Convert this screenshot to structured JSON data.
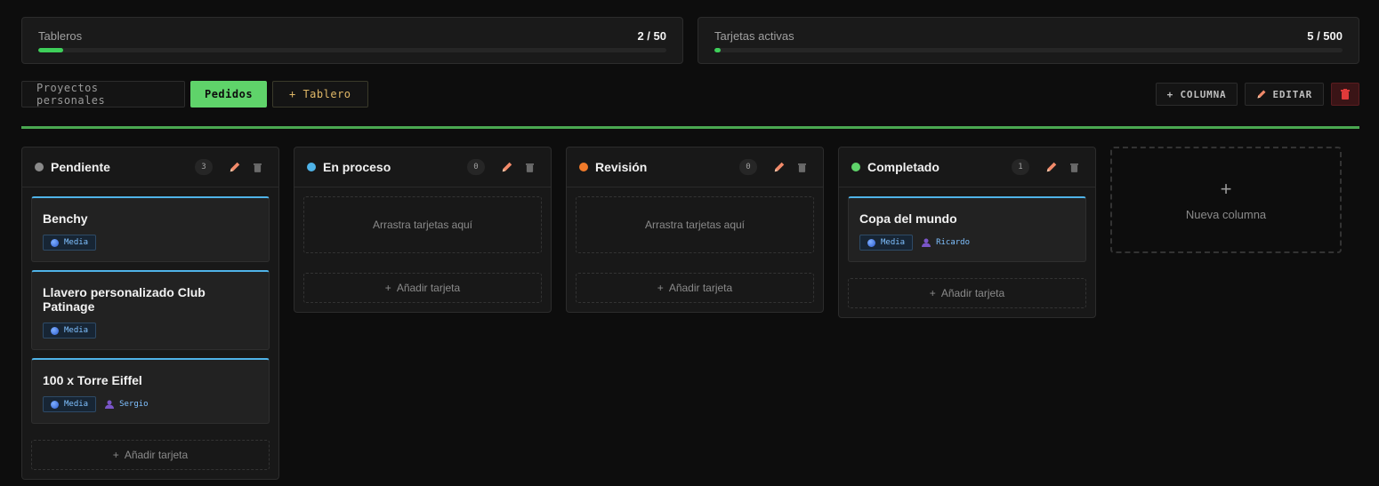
{
  "stats": [
    {
      "label": "Tableros",
      "value": "2 / 50",
      "progress": 0.04
    },
    {
      "label": "Tarjetas activas",
      "value": "5 / 500",
      "progress": 0.01
    }
  ],
  "tabs": [
    {
      "label": "Proyectos personales",
      "active": false
    },
    {
      "label": "Pedidos",
      "active": true
    },
    {
      "label": "+ Tablero",
      "active": false
    }
  ],
  "actions": {
    "add_column": "+ COLUMNA",
    "edit": "EDITAR",
    "edit_icon": "pencil-icon",
    "delete_icon": "trash-icon"
  },
  "accent": "#4aa851",
  "columns": [
    {
      "title": "Pendiente",
      "color": "#8a8a8a",
      "count": "3",
      "cards": [
        {
          "title": "Benchy",
          "priority": "Media",
          "assignee": ""
        },
        {
          "title": "Llavero personalizado Club Patinage",
          "priority": "Media",
          "assignee": ""
        },
        {
          "title": "100 x Torre Eiffel",
          "priority": "Media",
          "assignee": "Sergio"
        }
      ],
      "add_label": "Añadir tarjeta"
    },
    {
      "title": "En proceso",
      "color": "#4fb3e8",
      "count": "0",
      "cards": [],
      "empty_label": "Arrastra tarjetas aquí",
      "add_label": "Añadir tarjeta"
    },
    {
      "title": "Revisión",
      "color": "#f07a2a",
      "count": "0",
      "cards": [],
      "empty_label": "Arrastra tarjetas aquí",
      "add_label": "Añadir tarjeta"
    },
    {
      "title": "Completado",
      "color": "#5fd36a",
      "count": "1",
      "cards": [
        {
          "title": "Copa del mundo",
          "priority": "Media",
          "assignee": "Ricardo"
        }
      ],
      "add_label": "Añadir tarjeta"
    }
  ],
  "new_column": {
    "plus": "+",
    "label": "Nueva columna"
  }
}
